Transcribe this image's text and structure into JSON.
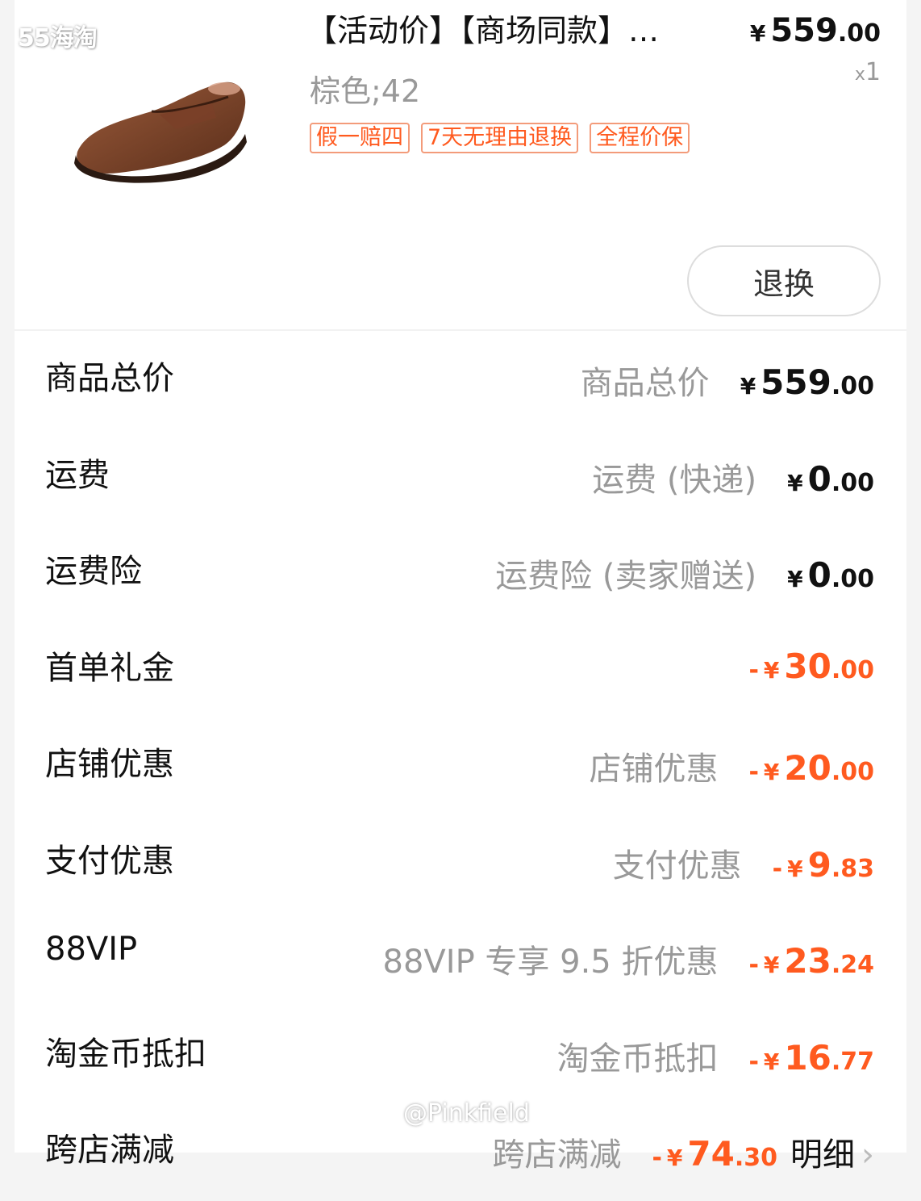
{
  "watermark_top": "55海淘",
  "watermark_bottom": "@Pinkfield",
  "item": {
    "title": "【活动价】【商场同款】…",
    "price_yen": "¥",
    "price_int": "559",
    "price_dec": ".00",
    "qty_x": "x",
    "qty": "1",
    "sku": "棕色;42",
    "tags": [
      "假一赔四",
      "7天无理由退换",
      "全程价保"
    ],
    "return_label": "退换",
    "image_icon": "brown-loafer-shoe"
  },
  "rows": [
    {
      "label": "商品总价",
      "desc": "商品总价",
      "minus": "",
      "yen": "¥",
      "int": "559",
      "dec": ".00"
    },
    {
      "label": "运费",
      "desc": "运费 (快递)",
      "minus": "",
      "yen": "¥",
      "int": "0",
      "dec": ".00"
    },
    {
      "label": "运费险",
      "desc": "运费险 (卖家赠送)",
      "minus": "",
      "yen": "¥",
      "int": "0",
      "dec": ".00"
    },
    {
      "label": "首单礼金",
      "desc": "",
      "minus": "-",
      "yen": "¥",
      "int": "30",
      "dec": ".00"
    },
    {
      "label": "店铺优惠",
      "desc": "店铺优惠",
      "minus": "-",
      "yen": "¥",
      "int": "20",
      "dec": ".00"
    },
    {
      "label": "支付优惠",
      "desc": "支付优惠",
      "minus": "-",
      "yen": "¥",
      "int": "9",
      "dec": ".83"
    },
    {
      "label": "88VIP",
      "desc": "88VIP 专享 9.5 折优惠",
      "minus": "-",
      "yen": "¥",
      "int": "23",
      "dec": ".24"
    },
    {
      "label": "淘金币抵扣",
      "desc": "淘金币抵扣",
      "minus": "-",
      "yen": "¥",
      "int": "16",
      "dec": ".77"
    },
    {
      "label": "跨店满减",
      "desc": "跨店满减",
      "minus": "-",
      "yen": "¥",
      "int": "74",
      "dec": ".30",
      "link": "明细"
    }
  ],
  "colors": {
    "accent": "#ff5a1f",
    "muted": "#999999"
  }
}
